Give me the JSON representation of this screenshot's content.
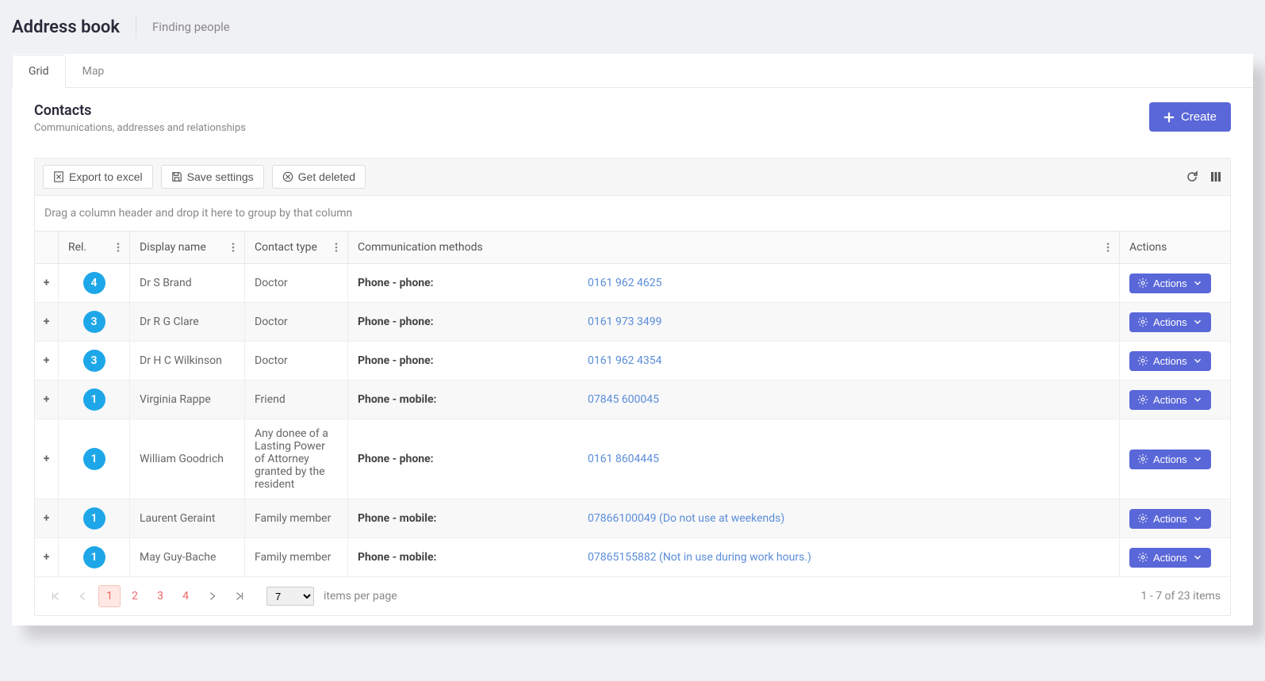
{
  "header": {
    "title": "Address book",
    "subtitle": "Finding people"
  },
  "tabs": [
    {
      "label": "Grid",
      "active": true
    },
    {
      "label": "Map",
      "active": false
    }
  ],
  "section": {
    "title": "Contacts",
    "subtitle": "Communications, addresses and relationships",
    "create_label": "Create"
  },
  "toolbar": {
    "export_label": "Export to excel",
    "save_label": "Save settings",
    "deleted_label": "Get deleted"
  },
  "grouping_hint": "Drag a column header and drop it here to group by that column",
  "columns": {
    "rel": "Rel.",
    "display_name": "Display name",
    "contact_type": "Contact type",
    "comm": "Communication methods",
    "actions": "Actions"
  },
  "actions_label": "Actions",
  "rows": [
    {
      "rel": "4",
      "name": "Dr S Brand",
      "type": "Doctor",
      "comm_label": "Phone - phone:",
      "comm_value": "0161 962 4625"
    },
    {
      "rel": "3",
      "name": "Dr R G Clare",
      "type": "Doctor",
      "comm_label": "Phone - phone:",
      "comm_value": "0161 973 3499"
    },
    {
      "rel": "3",
      "name": "Dr H C Wilkinson",
      "type": "Doctor",
      "comm_label": "Phone - phone:",
      "comm_value": "0161 962 4354"
    },
    {
      "rel": "1",
      "name": "Virginia Rappe",
      "type": "Friend",
      "comm_label": "Phone - mobile:",
      "comm_value": "07845 600045"
    },
    {
      "rel": "1",
      "name": "William Goodrich",
      "type": "Any donee of a Lasting Power of Attorney granted by the resident",
      "comm_label": "Phone - phone:",
      "comm_value": "0161 8604445"
    },
    {
      "rel": "1",
      "name": "Laurent Geraint",
      "type": "Family member",
      "comm_label": "Phone - mobile:",
      "comm_value": "07866100049 (Do not use at weekends)"
    },
    {
      "rel": "1",
      "name": "May Guy-Bache",
      "type": "Family member",
      "comm_label": "Phone - mobile:",
      "comm_value": "07865155882 (Not in use during work hours.)"
    }
  ],
  "pager": {
    "pages": [
      "1",
      "2",
      "3",
      "4"
    ],
    "current": "1",
    "page_size": "7",
    "per_page_label": "items per page",
    "info": "1 - 7 of 23 items"
  }
}
